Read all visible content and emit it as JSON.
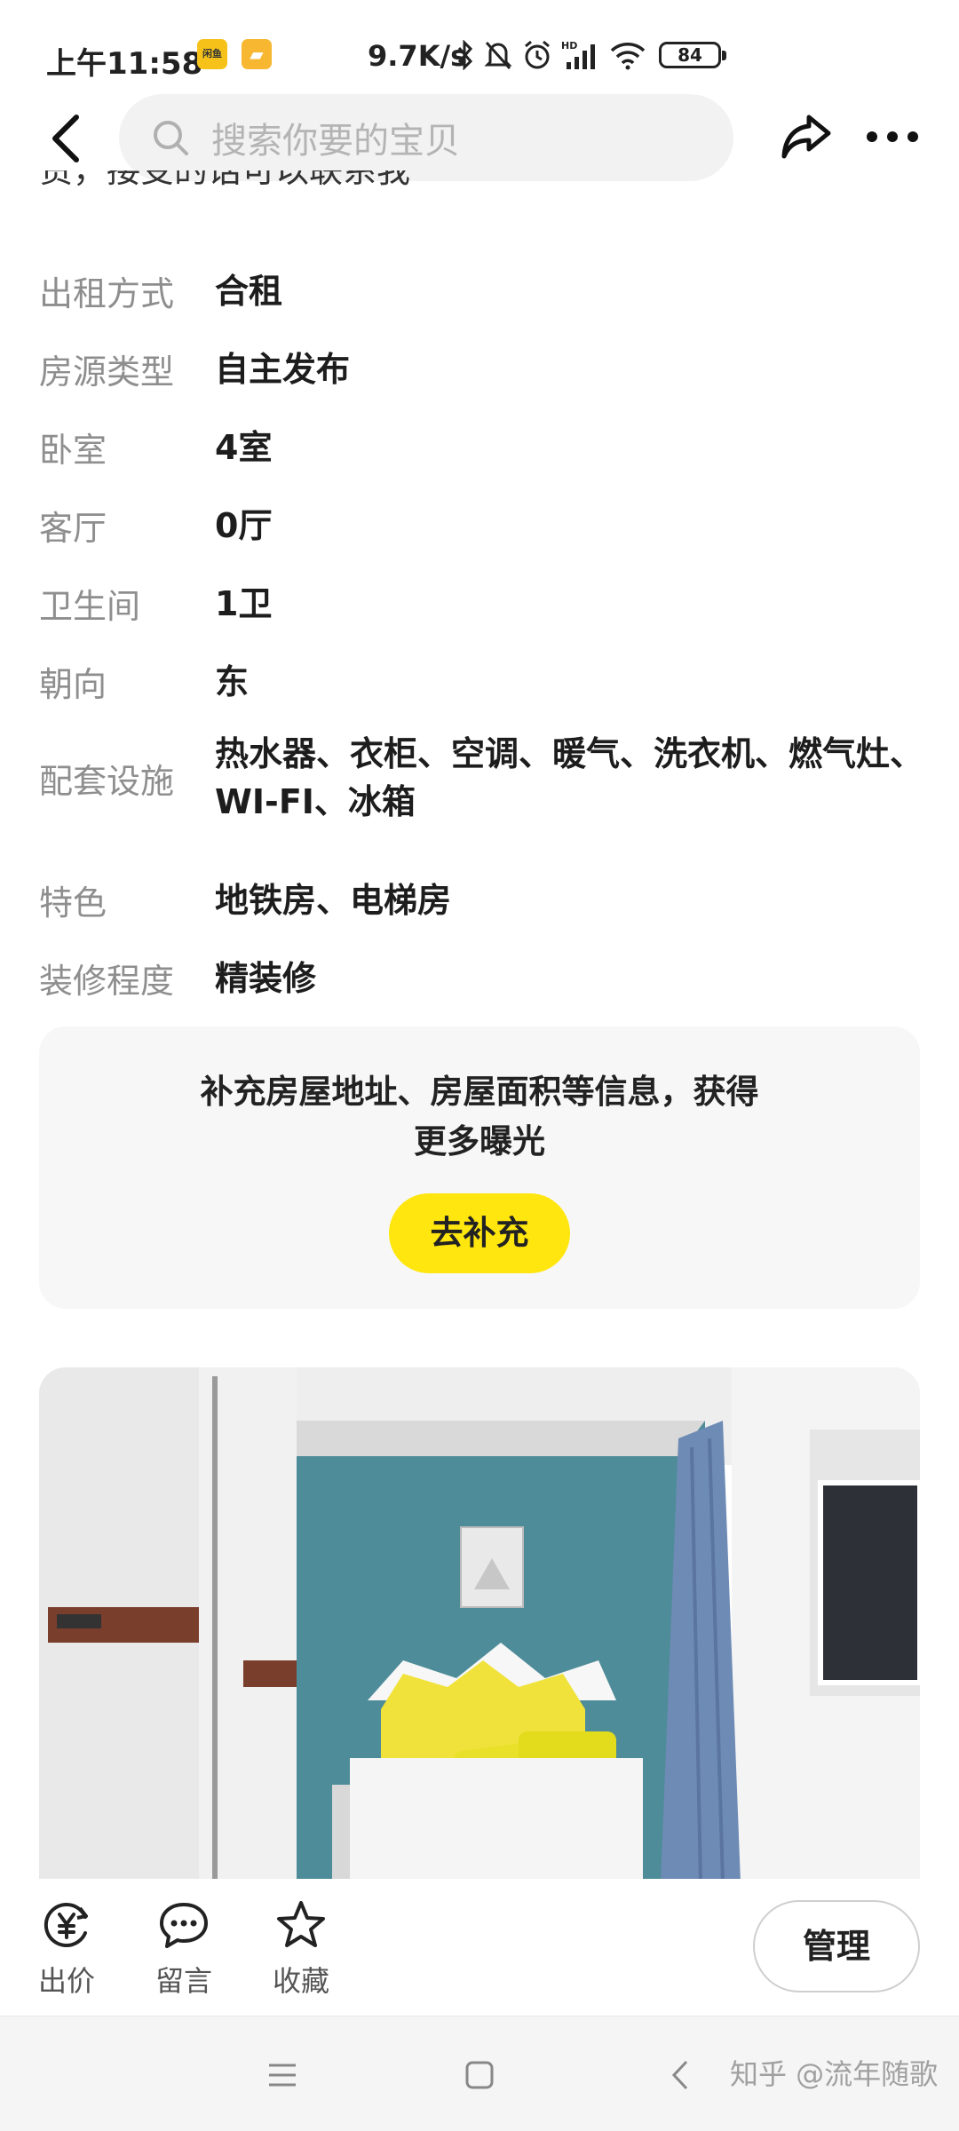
{
  "status_bar": {
    "time": "上午11:58",
    "badge_1": "闲鱼",
    "speed": "9.7K/s",
    "battery": "84"
  },
  "header": {
    "search_placeholder": "搜索你要的宝贝"
  },
  "cut_text": "责，接受的话可以联系我",
  "details": [
    {
      "label": "出租方式",
      "value": "合租"
    },
    {
      "label": "房源类型",
      "value": "自主发布"
    },
    {
      "label": "卧室",
      "value": "4室"
    },
    {
      "label": "客厅",
      "value": "0厅"
    },
    {
      "label": "卫生间",
      "value": "1卫"
    },
    {
      "label": "朝向",
      "value": "东"
    },
    {
      "label": "配套设施",
      "value": "热水器、衣柜、空调、暖气、洗衣机、燃气灶、WI-FI、冰箱"
    },
    {
      "label": "特色",
      "value": "地铁房、电梯房"
    },
    {
      "label": "装修程度",
      "value": "精装修"
    }
  ],
  "prompt": {
    "line1": "补充房屋地址、房屋面积等信息，获得",
    "line2": "更多曝光",
    "button": "去补充"
  },
  "actions": {
    "offer": "出价",
    "comment": "留言",
    "favorite": "收藏",
    "manage": "管理"
  },
  "watermark": "知乎 @流年随歌",
  "colors": {
    "accent_yellow": "#ffe60f",
    "label_gray": "#8e8e8e",
    "wall_teal": "#4e8c99"
  }
}
